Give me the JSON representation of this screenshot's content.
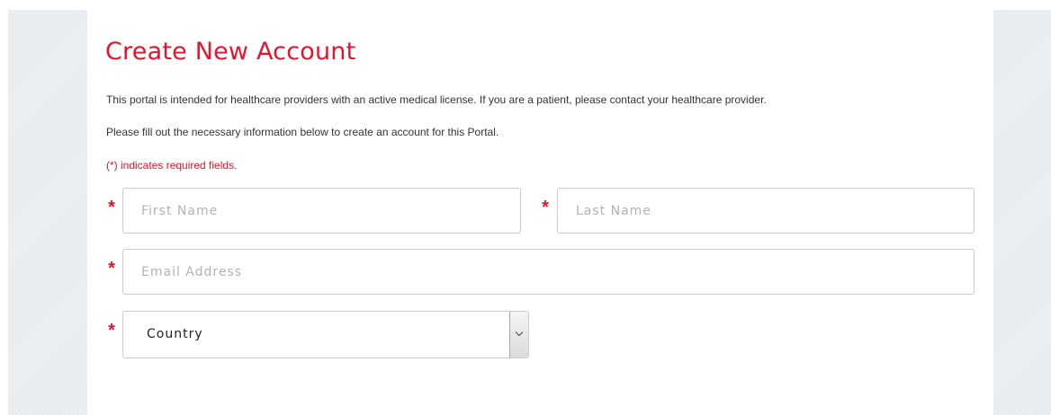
{
  "form": {
    "title": "Create New Account",
    "intro_text": "This portal is intended for healthcare providers with an active medical license. If you are a patient, please contact your healthcare provider.",
    "instructions_text": "Please fill out the necessary information below to create an account for this Portal.",
    "required_note": "(*) indicates required fields.",
    "required_marker": "*",
    "accent_color": "#e8132d",
    "fields": {
      "first_name": {
        "placeholder": "First Name",
        "value": ""
      },
      "last_name": {
        "placeholder": "Last Name",
        "value": ""
      },
      "email": {
        "placeholder": "Email Address",
        "value": ""
      },
      "country": {
        "selected": "Country",
        "icon": "chevron-down-icon"
      }
    }
  }
}
